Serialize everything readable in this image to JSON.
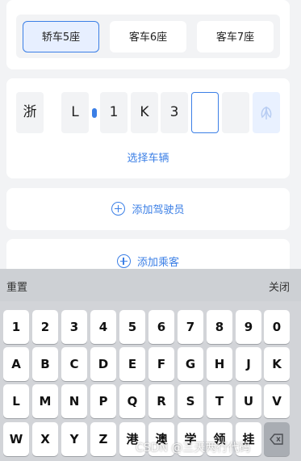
{
  "vehicle_types": [
    {
      "label": "轿车5座",
      "selected": true
    },
    {
      "label": "客车6座",
      "selected": false
    },
    {
      "label": "客车7座",
      "selected": false
    }
  ],
  "plate": {
    "chars": [
      "浙",
      "L",
      "1",
      "K",
      "3",
      "",
      ""
    ],
    "active_index": 5,
    "ev_icon": "new-energy-leaf-icon"
  },
  "links": {
    "select_vehicle": "选择车辆",
    "add_driver": "添加驾驶员",
    "add_passenger": "添加乘客"
  },
  "keyboard": {
    "reset_label": "重置",
    "close_label": "关闭",
    "rows": [
      [
        "1",
        "2",
        "3",
        "4",
        "5",
        "6",
        "7",
        "8",
        "9",
        "0"
      ],
      [
        "A",
        "B",
        "C",
        "D",
        "E",
        "F",
        "G",
        "H",
        "J",
        "K"
      ],
      [
        "L",
        "M",
        "N",
        "P",
        "Q",
        "R",
        "S",
        "T",
        "U",
        "V"
      ],
      [
        "W",
        "X",
        "Y",
        "Z",
        "港",
        "澳",
        "学",
        "领",
        "挂"
      ]
    ],
    "delete_icon": "backspace-icon"
  },
  "watermark": "CSDN @三天两行代码",
  "colors": {
    "accent": "#3b7fe6",
    "background": "#f2f3f5",
    "keyboard": "#d2d4d8"
  }
}
